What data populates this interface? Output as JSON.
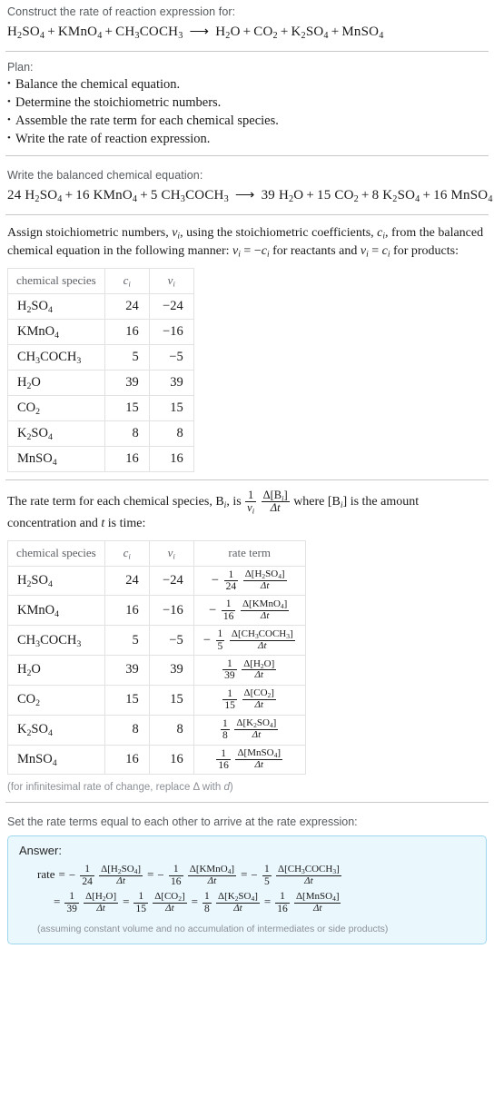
{
  "header": {
    "prompt": "Construct the rate of reaction expression for:",
    "equation": {
      "reactants": [
        {
          "formula": "H2SO4",
          "html": "H<sub>2</sub>SO<sub>4</sub>"
        },
        {
          "formula": "KMnO4",
          "html": "KMnO<sub>4</sub>"
        },
        {
          "formula": "CH3COCH3",
          "html": "CH<sub>3</sub>COCH<sub>3</sub>"
        }
      ],
      "products": [
        {
          "formula": "H2O",
          "html": "H<sub>2</sub>O"
        },
        {
          "formula": "CO2",
          "html": "CO<sub>2</sub>"
        },
        {
          "formula": "K2SO4",
          "html": "K<sub>2</sub>SO<sub>4</sub>"
        },
        {
          "formula": "MnSO4",
          "html": "MnSO<sub>4</sub>"
        }
      ],
      "arrow": "⟶",
      "plus": "+"
    }
  },
  "plan": {
    "title": "Plan:",
    "bullet": "•",
    "items": [
      "Balance the chemical equation.",
      "Determine the stoichiometric numbers.",
      "Assemble the rate term for each chemical species.",
      "Write the rate of reaction expression."
    ]
  },
  "balanced": {
    "prompt": "Write the balanced chemical equation:",
    "reactants": [
      {
        "coef": "24",
        "html": "H<sub>2</sub>SO<sub>4</sub>"
      },
      {
        "coef": "16",
        "html": "KMnO<sub>4</sub>"
      },
      {
        "coef": "5",
        "html": "CH<sub>3</sub>COCH<sub>3</sub>"
      }
    ],
    "products": [
      {
        "coef": "39",
        "html": "H<sub>2</sub>O"
      },
      {
        "coef": "15",
        "html": "CO<sub>2</sub>"
      },
      {
        "coef": "8",
        "html": "K<sub>2</sub>SO<sub>4</sub>"
      },
      {
        "coef": "16",
        "html": "MnSO<sub>4</sub>"
      }
    ]
  },
  "assign": {
    "text_part1": "Assign stoichiometric numbers, ",
    "nu_i": "ν",
    "text_part2": ", using the stoichiometric coefficients, ",
    "c_i": "c",
    "text_part3": ", from the balanced chemical equation in the following manner: ",
    "rule_reactants": "ν",
    "text_part4": " for reactants and ",
    "text_part5": " for products:"
  },
  "stoich_table": {
    "headers": {
      "species": "chemical species",
      "c": "c",
      "v": "ν",
      "sub": "i"
    },
    "rows": [
      {
        "species": "H<sub>2</sub>SO<sub>4</sub>",
        "c": "24",
        "v": "−24"
      },
      {
        "species": "KMnO<sub>4</sub>",
        "c": "16",
        "v": "−16"
      },
      {
        "species": "CH<sub>3</sub>COCH<sub>3</sub>",
        "c": "5",
        "v": "−5"
      },
      {
        "species": "H<sub>2</sub>O",
        "c": "39",
        "v": "39"
      },
      {
        "species": "CO<sub>2</sub>",
        "c": "15",
        "v": "15"
      },
      {
        "species": "K<sub>2</sub>SO<sub>4</sub>",
        "c": "8",
        "v": "8"
      },
      {
        "species": "MnSO<sub>4</sub>",
        "c": "16",
        "v": "16"
      }
    ]
  },
  "rate_intro": {
    "p1": "The rate term for each chemical species, B",
    "p2": ", is ",
    "p3": " where [B",
    "p4": "] is the amount concentration and ",
    "t": "t",
    "p5": " is time:",
    "frac_num": "1",
    "frac_den": "ν",
    "delta_num": "Δ[B",
    "delta_den": "Δt"
  },
  "rate_table": {
    "headers": {
      "species": "chemical species",
      "c": "c",
      "v": "ν",
      "rate": "rate term"
    },
    "rows": [
      {
        "species": "H<sub>2</sub>SO<sub>4</sub>",
        "c": "24",
        "v": "−24",
        "sign": "−",
        "denom": "24",
        "conc": "Δ[H<sub>2</sub>SO<sub>4</sub>]",
        "dt": "Δt"
      },
      {
        "species": "KMnO<sub>4</sub>",
        "c": "16",
        "v": "−16",
        "sign": "−",
        "denom": "16",
        "conc": "Δ[KMnO<sub>4</sub>]",
        "dt": "Δt"
      },
      {
        "species": "CH<sub>3</sub>COCH<sub>3</sub>",
        "c": "5",
        "v": "−5",
        "sign": "−",
        "denom": "5",
        "conc": "Δ[CH<sub>3</sub>COCH<sub>3</sub>]",
        "dt": "Δt"
      },
      {
        "species": "H<sub>2</sub>O",
        "c": "39",
        "v": "39",
        "sign": "",
        "denom": "39",
        "conc": "Δ[H<sub>2</sub>O]",
        "dt": "Δt"
      },
      {
        "species": "CO<sub>2</sub>",
        "c": "15",
        "v": "15",
        "sign": "",
        "denom": "15",
        "conc": "Δ[CO<sub>2</sub>]",
        "dt": "Δt"
      },
      {
        "species": "K<sub>2</sub>SO<sub>4</sub>",
        "c": "8",
        "v": "8",
        "sign": "",
        "denom": "8",
        "conc": "Δ[K<sub>2</sub>SO<sub>4</sub>]",
        "dt": "Δt"
      },
      {
        "species": "MnSO<sub>4</sub>",
        "c": "16",
        "v": "16",
        "sign": "",
        "denom": "16",
        "conc": "Δ[MnSO<sub>4</sub>]",
        "dt": "Δt"
      }
    ],
    "footnote_pre": "(for infinitesimal rate of change, replace Δ with ",
    "footnote_d": "d",
    "footnote_post": ")"
  },
  "set_rate_prompt": "Set the rate terms equal to each other to arrive at the rate expression:",
  "answer": {
    "label": "Answer:",
    "rate_word": "rate",
    "equals": "=",
    "terms": [
      {
        "sign": "−",
        "denom": "24",
        "conc": "Δ[H<sub>2</sub>SO<sub>4</sub>]",
        "dt": "Δt"
      },
      {
        "sign": "−",
        "denom": "16",
        "conc": "Δ[KMnO<sub>4</sub>]",
        "dt": "Δt"
      },
      {
        "sign": "−",
        "denom": "5",
        "conc": "Δ[CH<sub>3</sub>COCH<sub>3</sub>]",
        "dt": "Δt"
      },
      {
        "sign": "",
        "denom": "39",
        "conc": "Δ[H<sub>2</sub>O]",
        "dt": "Δt"
      },
      {
        "sign": "",
        "denom": "15",
        "conc": "Δ[CO<sub>2</sub>]",
        "dt": "Δt"
      },
      {
        "sign": "",
        "denom": "8",
        "conc": "Δ[K<sub>2</sub>SO<sub>4</sub>]",
        "dt": "Δt"
      },
      {
        "sign": "",
        "denom": "16",
        "conc": "Δ[MnSO<sub>4</sub>]",
        "dt": "Δt"
      }
    ],
    "numerator_one": "1",
    "note": "(assuming constant volume and no accumulation of intermediates or side products)",
    "box_bg": "#eaf7fd",
    "box_border": "#9dd7ee"
  }
}
